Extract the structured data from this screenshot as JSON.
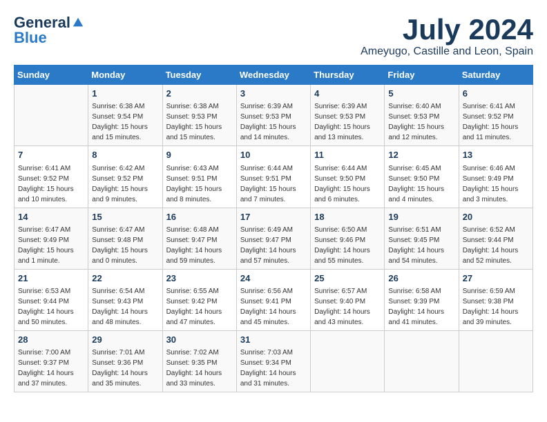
{
  "header": {
    "logo_general": "General",
    "logo_blue": "Blue",
    "title": "July 2024",
    "subtitle": "Ameyugo, Castille and Leon, Spain"
  },
  "weekdays": [
    "Sunday",
    "Monday",
    "Tuesday",
    "Wednesday",
    "Thursday",
    "Friday",
    "Saturday"
  ],
  "weeks": [
    [
      {
        "day": null
      },
      {
        "day": "1",
        "sunrise": "Sunrise: 6:38 AM",
        "sunset": "Sunset: 9:54 PM",
        "daylight": "Daylight: 15 hours and 15 minutes."
      },
      {
        "day": "2",
        "sunrise": "Sunrise: 6:38 AM",
        "sunset": "Sunset: 9:53 PM",
        "daylight": "Daylight: 15 hours and 15 minutes."
      },
      {
        "day": "3",
        "sunrise": "Sunrise: 6:39 AM",
        "sunset": "Sunset: 9:53 PM",
        "daylight": "Daylight: 15 hours and 14 minutes."
      },
      {
        "day": "4",
        "sunrise": "Sunrise: 6:39 AM",
        "sunset": "Sunset: 9:53 PM",
        "daylight": "Daylight: 15 hours and 13 minutes."
      },
      {
        "day": "5",
        "sunrise": "Sunrise: 6:40 AM",
        "sunset": "Sunset: 9:53 PM",
        "daylight": "Daylight: 15 hours and 12 minutes."
      },
      {
        "day": "6",
        "sunrise": "Sunrise: 6:41 AM",
        "sunset": "Sunset: 9:52 PM",
        "daylight": "Daylight: 15 hours and 11 minutes."
      }
    ],
    [
      {
        "day": "7",
        "sunrise": "Sunrise: 6:41 AM",
        "sunset": "Sunset: 9:52 PM",
        "daylight": "Daylight: 15 hours and 10 minutes."
      },
      {
        "day": "8",
        "sunrise": "Sunrise: 6:42 AM",
        "sunset": "Sunset: 9:52 PM",
        "daylight": "Daylight: 15 hours and 9 minutes."
      },
      {
        "day": "9",
        "sunrise": "Sunrise: 6:43 AM",
        "sunset": "Sunset: 9:51 PM",
        "daylight": "Daylight: 15 hours and 8 minutes."
      },
      {
        "day": "10",
        "sunrise": "Sunrise: 6:44 AM",
        "sunset": "Sunset: 9:51 PM",
        "daylight": "Daylight: 15 hours and 7 minutes."
      },
      {
        "day": "11",
        "sunrise": "Sunrise: 6:44 AM",
        "sunset": "Sunset: 9:50 PM",
        "daylight": "Daylight: 15 hours and 6 minutes."
      },
      {
        "day": "12",
        "sunrise": "Sunrise: 6:45 AM",
        "sunset": "Sunset: 9:50 PM",
        "daylight": "Daylight: 15 hours and 4 minutes."
      },
      {
        "day": "13",
        "sunrise": "Sunrise: 6:46 AM",
        "sunset": "Sunset: 9:49 PM",
        "daylight": "Daylight: 15 hours and 3 minutes."
      }
    ],
    [
      {
        "day": "14",
        "sunrise": "Sunrise: 6:47 AM",
        "sunset": "Sunset: 9:49 PM",
        "daylight": "Daylight: 15 hours and 1 minute."
      },
      {
        "day": "15",
        "sunrise": "Sunrise: 6:47 AM",
        "sunset": "Sunset: 9:48 PM",
        "daylight": "Daylight: 15 hours and 0 minutes."
      },
      {
        "day": "16",
        "sunrise": "Sunrise: 6:48 AM",
        "sunset": "Sunset: 9:47 PM",
        "daylight": "Daylight: 14 hours and 59 minutes."
      },
      {
        "day": "17",
        "sunrise": "Sunrise: 6:49 AM",
        "sunset": "Sunset: 9:47 PM",
        "daylight": "Daylight: 14 hours and 57 minutes."
      },
      {
        "day": "18",
        "sunrise": "Sunrise: 6:50 AM",
        "sunset": "Sunset: 9:46 PM",
        "daylight": "Daylight: 14 hours and 55 minutes."
      },
      {
        "day": "19",
        "sunrise": "Sunrise: 6:51 AM",
        "sunset": "Sunset: 9:45 PM",
        "daylight": "Daylight: 14 hours and 54 minutes."
      },
      {
        "day": "20",
        "sunrise": "Sunrise: 6:52 AM",
        "sunset": "Sunset: 9:44 PM",
        "daylight": "Daylight: 14 hours and 52 minutes."
      }
    ],
    [
      {
        "day": "21",
        "sunrise": "Sunrise: 6:53 AM",
        "sunset": "Sunset: 9:44 PM",
        "daylight": "Daylight: 14 hours and 50 minutes."
      },
      {
        "day": "22",
        "sunrise": "Sunrise: 6:54 AM",
        "sunset": "Sunset: 9:43 PM",
        "daylight": "Daylight: 14 hours and 48 minutes."
      },
      {
        "day": "23",
        "sunrise": "Sunrise: 6:55 AM",
        "sunset": "Sunset: 9:42 PM",
        "daylight": "Daylight: 14 hours and 47 minutes."
      },
      {
        "day": "24",
        "sunrise": "Sunrise: 6:56 AM",
        "sunset": "Sunset: 9:41 PM",
        "daylight": "Daylight: 14 hours and 45 minutes."
      },
      {
        "day": "25",
        "sunrise": "Sunrise: 6:57 AM",
        "sunset": "Sunset: 9:40 PM",
        "daylight": "Daylight: 14 hours and 43 minutes."
      },
      {
        "day": "26",
        "sunrise": "Sunrise: 6:58 AM",
        "sunset": "Sunset: 9:39 PM",
        "daylight": "Daylight: 14 hours and 41 minutes."
      },
      {
        "day": "27",
        "sunrise": "Sunrise: 6:59 AM",
        "sunset": "Sunset: 9:38 PM",
        "daylight": "Daylight: 14 hours and 39 minutes."
      }
    ],
    [
      {
        "day": "28",
        "sunrise": "Sunrise: 7:00 AM",
        "sunset": "Sunset: 9:37 PM",
        "daylight": "Daylight: 14 hours and 37 minutes."
      },
      {
        "day": "29",
        "sunrise": "Sunrise: 7:01 AM",
        "sunset": "Sunset: 9:36 PM",
        "daylight": "Daylight: 14 hours and 35 minutes."
      },
      {
        "day": "30",
        "sunrise": "Sunrise: 7:02 AM",
        "sunset": "Sunset: 9:35 PM",
        "daylight": "Daylight: 14 hours and 33 minutes."
      },
      {
        "day": "31",
        "sunrise": "Sunrise: 7:03 AM",
        "sunset": "Sunset: 9:34 PM",
        "daylight": "Daylight: 14 hours and 31 minutes."
      },
      {
        "day": null
      },
      {
        "day": null
      },
      {
        "day": null
      }
    ]
  ]
}
